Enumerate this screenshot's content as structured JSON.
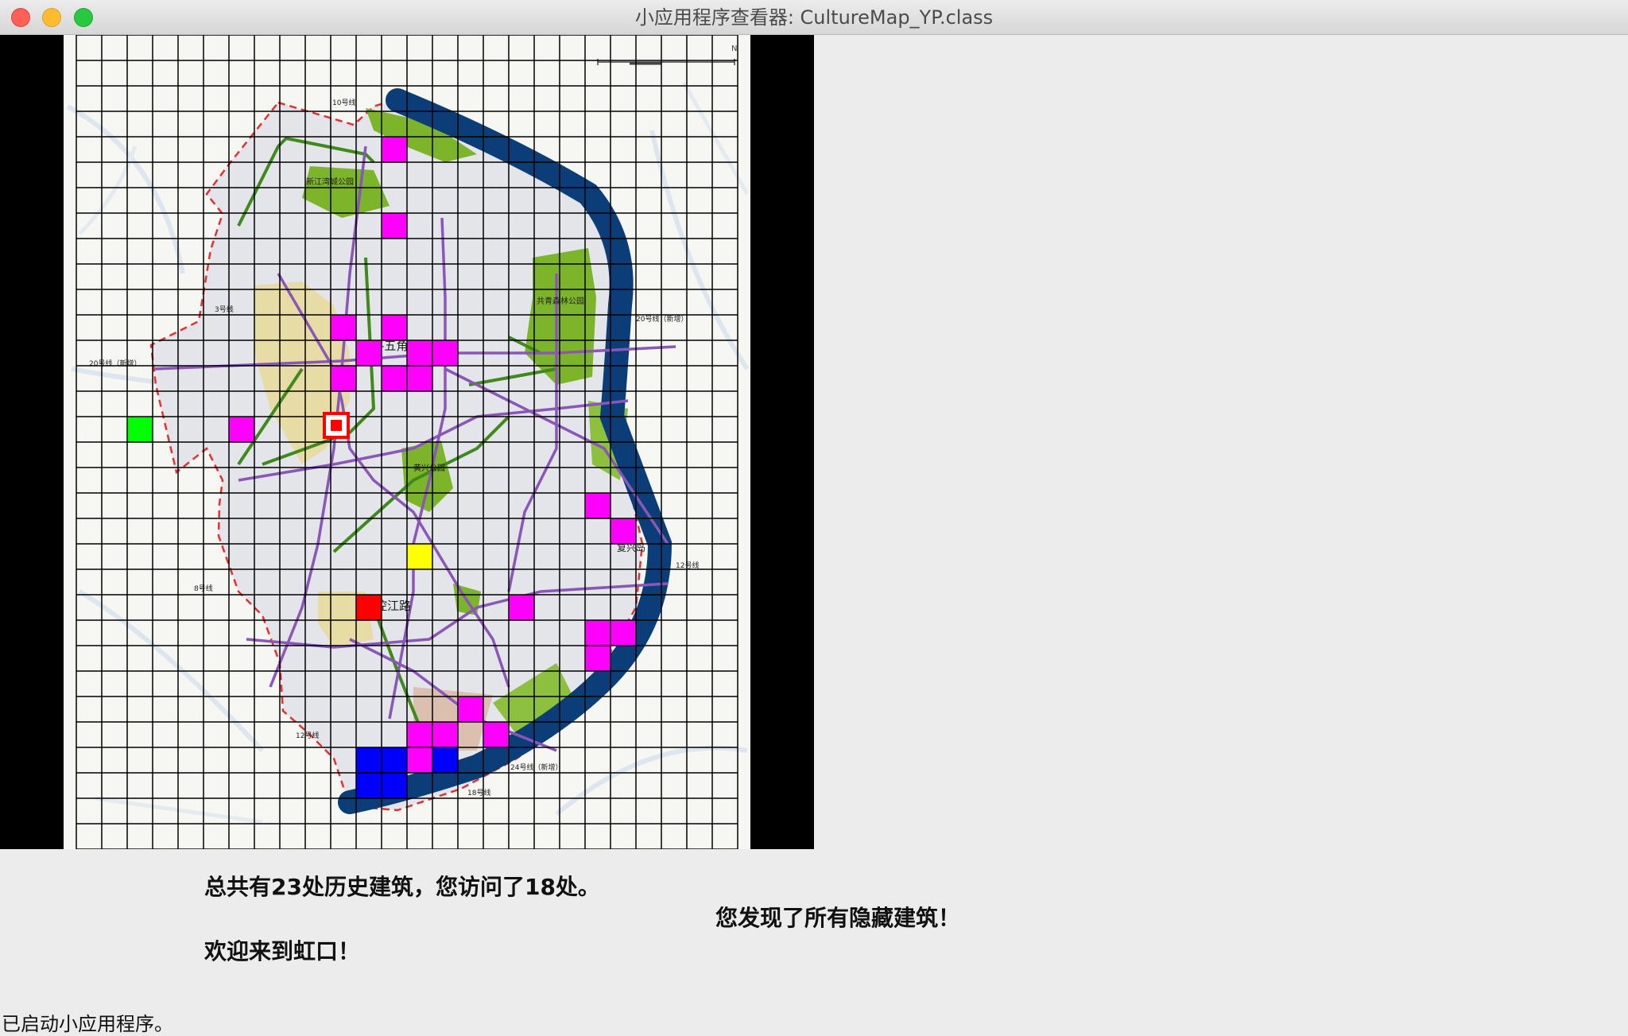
{
  "window": {
    "title": "小应用程序查看器: CultureMap_YP.class",
    "controls": [
      "close",
      "minimize",
      "zoom"
    ]
  },
  "map": {
    "grid_columns": 26,
    "grid_rows": 32,
    "labels": {
      "center_plaza": "江湾-五角场",
      "kongjiang": "控江路",
      "fuxing_island": "复兴岛",
      "gongqing_park": "共青森林公园",
      "xinjiang_wan_park": "新江湾城公园",
      "huangxing_park": "黄兴公园",
      "line_20_new_west": "20号线（新增）",
      "line_20_new_east": "20号线（新增）",
      "line_12": "12号线",
      "line_12_east": "12号线",
      "line_8": "8号线",
      "line_10": "10号线",
      "line_18": "18号线",
      "line_24_new": "24号线（新增）",
      "line_3": "3号线"
    },
    "colors": {
      "visited": "#ff00ff",
      "hidden_found": "#0000ff",
      "start": "#00ff00",
      "current": "#ffff00",
      "landmark": "#ff0000",
      "river": "#0b3e78",
      "park": "#7cb42a",
      "boundary": "#e53030",
      "metro": "#8a56b8"
    },
    "visited_cells": [
      [
        12,
        4
      ],
      [
        12,
        7
      ],
      [
        10,
        11
      ],
      [
        12,
        11
      ],
      [
        11,
        12
      ],
      [
        13,
        12
      ],
      [
        14,
        12
      ],
      [
        10,
        13
      ],
      [
        12,
        13
      ],
      [
        13,
        13
      ],
      [
        6,
        15
      ],
      [
        20,
        18
      ],
      [
        21,
        19
      ],
      [
        17,
        22
      ],
      [
        20,
        23
      ],
      [
        21,
        23
      ],
      [
        20,
        24
      ],
      [
        15,
        26
      ],
      [
        13,
        27
      ],
      [
        14,
        27
      ],
      [
        16,
        27
      ],
      [
        13,
        28
      ]
    ],
    "hidden_cells": [
      [
        11,
        28
      ],
      [
        12,
        28
      ],
      [
        14,
        28
      ],
      [
        11,
        29
      ],
      [
        12,
        29
      ]
    ],
    "start_cell": [
      2,
      15
    ],
    "current_cell": [
      13,
      20
    ],
    "landmark_cell": [
      11,
      22
    ]
  },
  "messages": {
    "total": "总共有23处历史建筑，您访问了18处。",
    "hidden": "您发现了所有隐藏建筑！",
    "welcome": "欢迎来到虹口！"
  },
  "status_bar": "已启动小应用程序。"
}
